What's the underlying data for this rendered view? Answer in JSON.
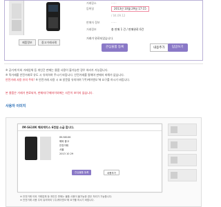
{
  "listing": {
    "rows": [
      {
        "label": "거래장소",
        "value": "",
        "muted_value": "······"
      },
      {
        "label": "등록일",
        "value": "2013년 10월 29일 17:15"
      },
      {
        "label": "",
        "value": "",
        "muted_value": "/ 04.09.12"
      },
      {
        "label": "판매자 정보",
        "value": "",
        "muted_value": "······"
      },
      {
        "label": "거래정보",
        "value": "총 판매 1 건 / 판매완료 0건"
      }
    ],
    "thumbnail_buttons": [
      "제품정보",
      "중고거래사례"
    ],
    "submit_note": "거래가 완료되었습니다.",
    "btn_interest": "관심물품 등록",
    "btn_list": "내용추가",
    "btn_purple_right": "답글쓰기"
  },
  "notes": {
    "lines": [
      "※ 공기계 이외 거래업체 등 개인간 판매는 물품 사용이 불가능한 경우 처리가 가능합니다.",
      "※ 직거래를 안전거래로 유도 시 유의하여 주시기 바랍니다. 안전거래를 통해야 판매자 피해가 없습니다.",
      "※ 안전거래 사용 시 표 방문을 유의하여 '(주)케이앤오'에 요구를 하시기 바랍니다."
    ],
    "highlight": "안전거래 사용 유의 주의!"
  },
  "warning": "본 물품은 거래가 완료되어, 판매자/구매자이외에는 사진이 보이지 않습니다.",
  "section_title": "사용자 이미지",
  "screenshot": {
    "title": "IM-S610K 해외케이스 6천원 소급 합니다.",
    "table": [
      "IM-S610K",
      "해외 중고",
      "안전거래",
      "서울",
      "2013 10 29"
    ],
    "btn_left": "관심물품 등록",
    "btn_right": "내용추가",
    "bottom": [
      "※ 안전거래 이외 거래업체 등 개인간 판매는 물품 사용이 불가능한 경우 처리가 가능합니다.",
      "※ 안전거래 사용 주의 유의하여 '(주)케이앤오'에 요구를 하시기 바랍니다."
    ]
  },
  "colors": {
    "accent": "#8a79c7",
    "warning": "#d6283b",
    "section": "#2b6fb6",
    "highlight_border": "#f08aa0"
  }
}
